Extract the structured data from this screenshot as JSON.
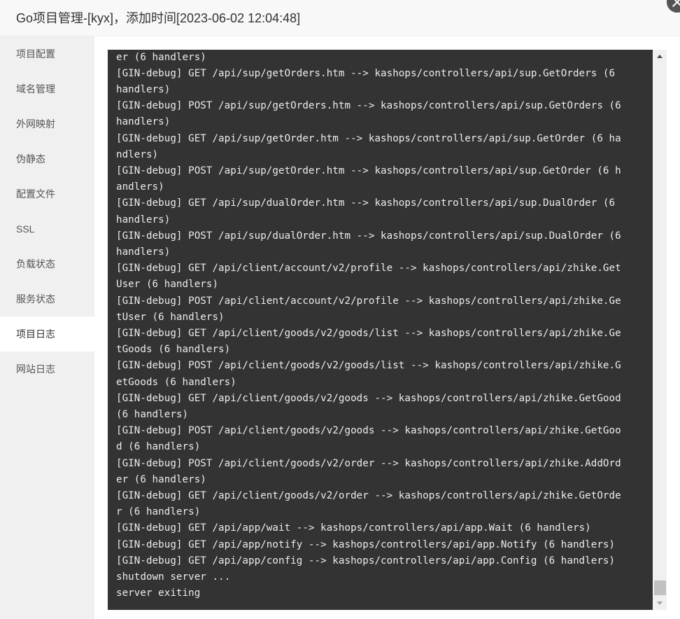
{
  "window": {
    "title": "Go项目管理-[kyx]，添加时间[2023-06-02 12:04:48]",
    "close_icon": "close-icon"
  },
  "sidebar": {
    "items": [
      {
        "label": "项目配置",
        "active": false
      },
      {
        "label": "域名管理",
        "active": false
      },
      {
        "label": "外网映射",
        "active": false
      },
      {
        "label": "伪静态",
        "active": false
      },
      {
        "label": "配置文件",
        "active": false
      },
      {
        "label": "SSL",
        "active": false
      },
      {
        "label": "负载状态",
        "active": false
      },
      {
        "label": "服务状态",
        "active": false
      },
      {
        "label": "项目日志",
        "active": true
      },
      {
        "label": "网站日志",
        "active": false
      }
    ]
  },
  "log": {
    "lines": [
      "er (6 handlers)",
      "[GIN-debug] GET /api/sup/getOrders.htm --> kashops/controllers/api/sup.GetOrders (6",
      "handlers)",
      "[GIN-debug] POST /api/sup/getOrders.htm --> kashops/controllers/api/sup.GetOrders (6",
      "handlers)",
      "[GIN-debug] GET /api/sup/getOrder.htm --> kashops/controllers/api/sup.GetOrder (6 ha",
      "ndlers)",
      "[GIN-debug] POST /api/sup/getOrder.htm --> kashops/controllers/api/sup.GetOrder (6 h",
      "andlers)",
      "[GIN-debug] GET /api/sup/dualOrder.htm --> kashops/controllers/api/sup.DualOrder (6",
      "handlers)",
      "[GIN-debug] POST /api/sup/dualOrder.htm --> kashops/controllers/api/sup.DualOrder (6",
      "handlers)",
      "[GIN-debug] GET /api/client/account/v2/profile --> kashops/controllers/api/zhike.Get",
      "User (6 handlers)",
      "[GIN-debug] POST /api/client/account/v2/profile --> kashops/controllers/api/zhike.Ge",
      "tUser (6 handlers)",
      "[GIN-debug] GET /api/client/goods/v2/goods/list --> kashops/controllers/api/zhike.Ge",
      "tGoods (6 handlers)",
      "[GIN-debug] POST /api/client/goods/v2/goods/list --> kashops/controllers/api/zhike.G",
      "etGoods (6 handlers)",
      "[GIN-debug] GET /api/client/goods/v2/goods --> kashops/controllers/api/zhike.GetGood",
      "(6 handlers)",
      "[GIN-debug] POST /api/client/goods/v2/goods --> kashops/controllers/api/zhike.GetGoo",
      "d (6 handlers)",
      "[GIN-debug] POST /api/client/goods/v2/order --> kashops/controllers/api/zhike.AddOrd",
      "er (6 handlers)",
      "[GIN-debug] GET /api/client/goods/v2/order --> kashops/controllers/api/zhike.GetOrde",
      "r (6 handlers)",
      "[GIN-debug] GET /api/app/wait --> kashops/controllers/api/app.Wait (6 handlers)",
      "[GIN-debug] GET /api/app/notify --> kashops/controllers/api/app.Notify (6 handlers)",
      "[GIN-debug] GET /api/app/config --> kashops/controllers/api/app.Config (6 handlers)",
      "shutdown server ...",
      "server exiting"
    ],
    "scroll_position": 1.0
  },
  "colors": {
    "log_background": "#333333",
    "log_text": "#ececec",
    "sidebar_background": "#f0f0f0",
    "active_item_background": "#ffffff"
  }
}
